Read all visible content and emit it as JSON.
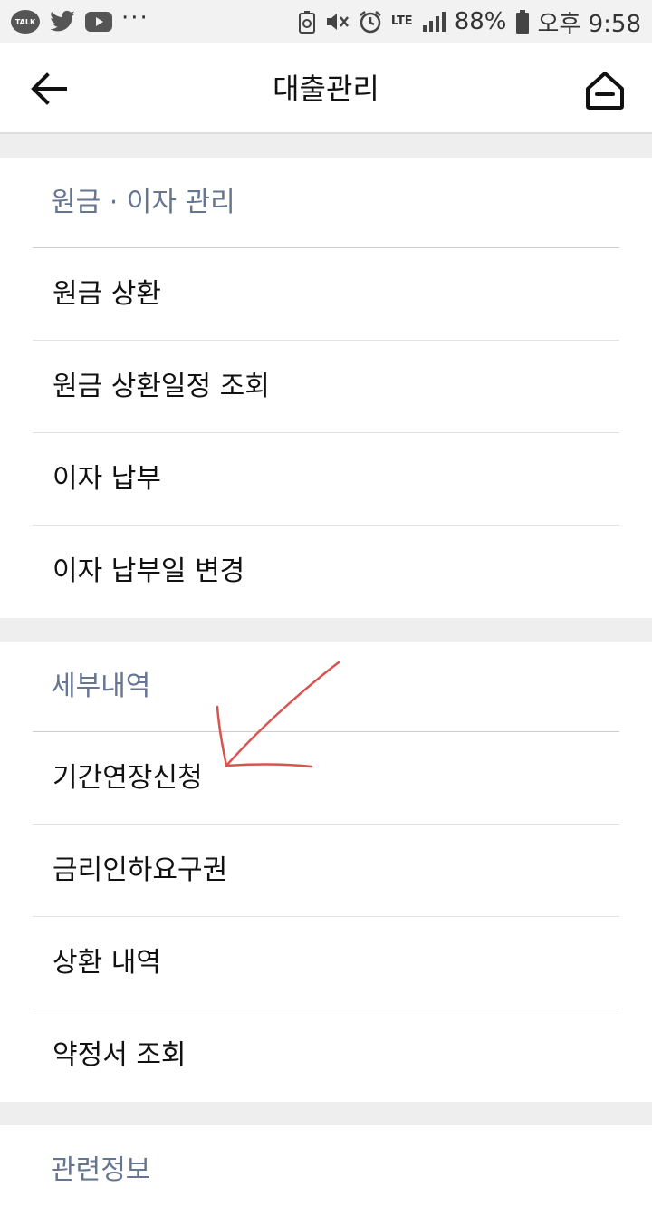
{
  "status_bar": {
    "talk_label": "TALK",
    "dots": "···",
    "lte": "LTE",
    "battery_percent": "88%",
    "time": "오후 9:58"
  },
  "header": {
    "title": "대출관리",
    "back_icon": "arrow-left-icon",
    "home_icon": "home-icon"
  },
  "sections": [
    {
      "title": "원금 · 이자 관리",
      "items": [
        {
          "label": "원금 상환"
        },
        {
          "label": "원금 상환일정 조회"
        },
        {
          "label": "이자 납부"
        },
        {
          "label": "이자 납부일 변경"
        }
      ]
    },
    {
      "title": "세부내역",
      "items": [
        {
          "label": "기간연장신청"
        },
        {
          "label": "금리인하요구권"
        },
        {
          "label": "상환 내역"
        },
        {
          "label": "약정서 조회"
        }
      ]
    },
    {
      "title": "관련정보"
    }
  ],
  "colors": {
    "section_title": "#667590",
    "annotation": "#d9534f"
  }
}
